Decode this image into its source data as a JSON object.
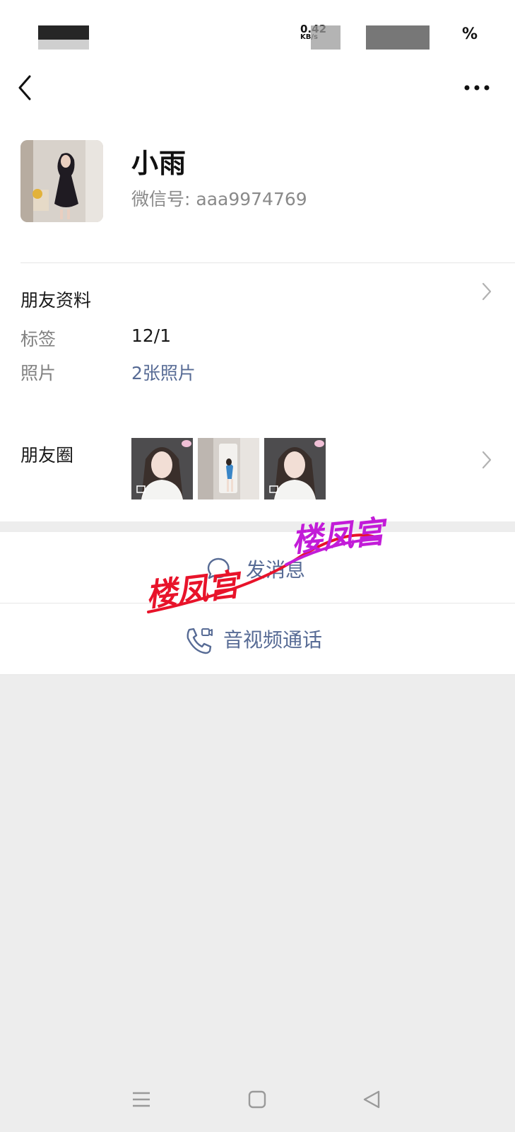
{
  "status_bar": {
    "speed_value": "0.42",
    "speed_unit": "KB/s",
    "battery_suffix": "%"
  },
  "profile": {
    "name": "小雨",
    "wechat_id": "微信号: aaa9974769"
  },
  "friend_info": {
    "title": "朋友资料",
    "rows": [
      {
        "label": "标签",
        "value": "12/1"
      },
      {
        "label": "照片",
        "value": "2张照片"
      }
    ]
  },
  "moments": {
    "title": "朋友圈"
  },
  "actions": {
    "send_message": "发消息",
    "av_call": "音视频通话"
  },
  "watermark": {
    "text_1": "楼凤宫",
    "text_2": "楼凤宫"
  },
  "colors": {
    "link": "#576b95",
    "background": "#ededed",
    "watermark_red": "#e8132a",
    "watermark_purple": "#c21cd8"
  }
}
